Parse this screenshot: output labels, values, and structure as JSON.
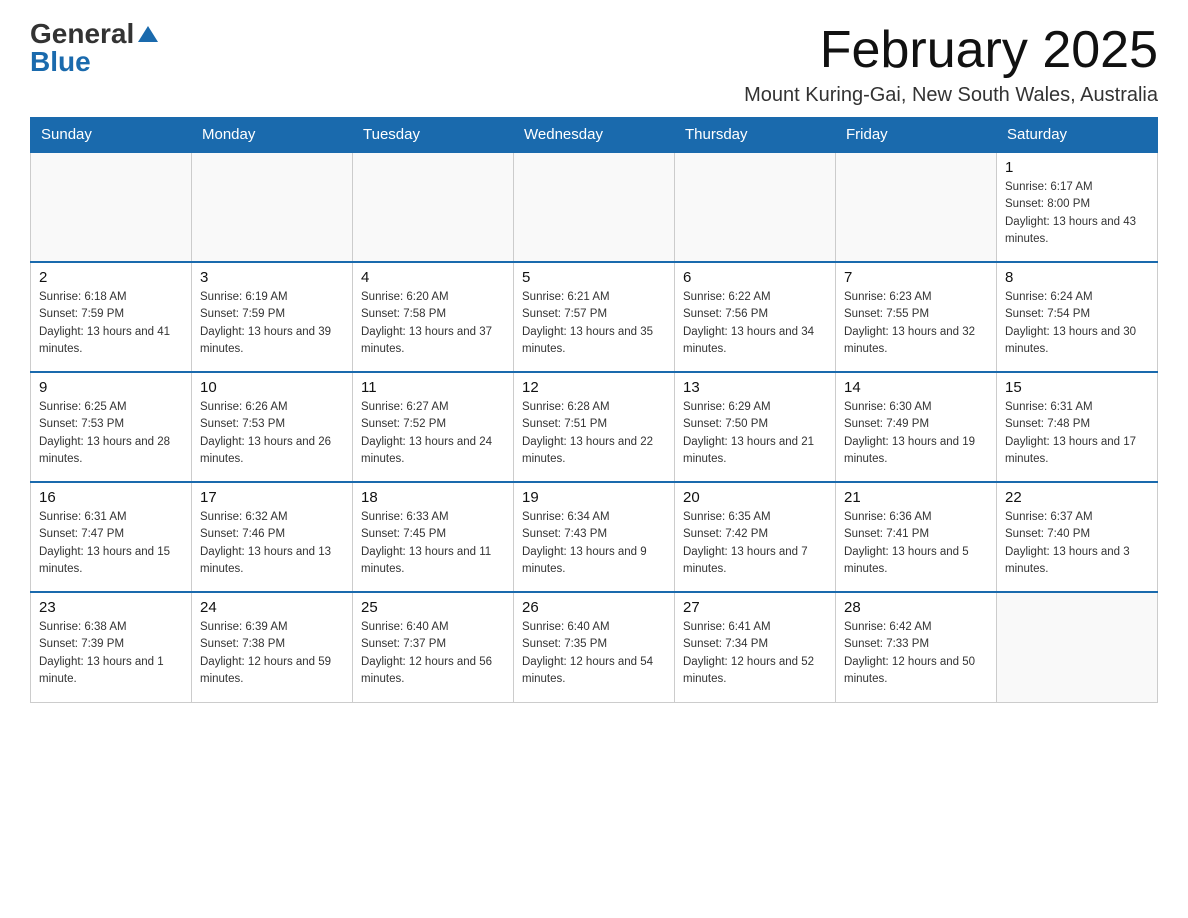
{
  "logo": {
    "general": "General",
    "blue": "Blue"
  },
  "title": "February 2025",
  "location": "Mount Kuring-Gai, New South Wales, Australia",
  "weekdays": [
    "Sunday",
    "Monday",
    "Tuesday",
    "Wednesday",
    "Thursday",
    "Friday",
    "Saturday"
  ],
  "weeks": [
    [
      {
        "day": "",
        "info": ""
      },
      {
        "day": "",
        "info": ""
      },
      {
        "day": "",
        "info": ""
      },
      {
        "day": "",
        "info": ""
      },
      {
        "day": "",
        "info": ""
      },
      {
        "day": "",
        "info": ""
      },
      {
        "day": "1",
        "info": "Sunrise: 6:17 AM\nSunset: 8:00 PM\nDaylight: 13 hours and 43 minutes."
      }
    ],
    [
      {
        "day": "2",
        "info": "Sunrise: 6:18 AM\nSunset: 7:59 PM\nDaylight: 13 hours and 41 minutes."
      },
      {
        "day": "3",
        "info": "Sunrise: 6:19 AM\nSunset: 7:59 PM\nDaylight: 13 hours and 39 minutes."
      },
      {
        "day": "4",
        "info": "Sunrise: 6:20 AM\nSunset: 7:58 PM\nDaylight: 13 hours and 37 minutes."
      },
      {
        "day": "5",
        "info": "Sunrise: 6:21 AM\nSunset: 7:57 PM\nDaylight: 13 hours and 35 minutes."
      },
      {
        "day": "6",
        "info": "Sunrise: 6:22 AM\nSunset: 7:56 PM\nDaylight: 13 hours and 34 minutes."
      },
      {
        "day": "7",
        "info": "Sunrise: 6:23 AM\nSunset: 7:55 PM\nDaylight: 13 hours and 32 minutes."
      },
      {
        "day": "8",
        "info": "Sunrise: 6:24 AM\nSunset: 7:54 PM\nDaylight: 13 hours and 30 minutes."
      }
    ],
    [
      {
        "day": "9",
        "info": "Sunrise: 6:25 AM\nSunset: 7:53 PM\nDaylight: 13 hours and 28 minutes."
      },
      {
        "day": "10",
        "info": "Sunrise: 6:26 AM\nSunset: 7:53 PM\nDaylight: 13 hours and 26 minutes."
      },
      {
        "day": "11",
        "info": "Sunrise: 6:27 AM\nSunset: 7:52 PM\nDaylight: 13 hours and 24 minutes."
      },
      {
        "day": "12",
        "info": "Sunrise: 6:28 AM\nSunset: 7:51 PM\nDaylight: 13 hours and 22 minutes."
      },
      {
        "day": "13",
        "info": "Sunrise: 6:29 AM\nSunset: 7:50 PM\nDaylight: 13 hours and 21 minutes."
      },
      {
        "day": "14",
        "info": "Sunrise: 6:30 AM\nSunset: 7:49 PM\nDaylight: 13 hours and 19 minutes."
      },
      {
        "day": "15",
        "info": "Sunrise: 6:31 AM\nSunset: 7:48 PM\nDaylight: 13 hours and 17 minutes."
      }
    ],
    [
      {
        "day": "16",
        "info": "Sunrise: 6:31 AM\nSunset: 7:47 PM\nDaylight: 13 hours and 15 minutes."
      },
      {
        "day": "17",
        "info": "Sunrise: 6:32 AM\nSunset: 7:46 PM\nDaylight: 13 hours and 13 minutes."
      },
      {
        "day": "18",
        "info": "Sunrise: 6:33 AM\nSunset: 7:45 PM\nDaylight: 13 hours and 11 minutes."
      },
      {
        "day": "19",
        "info": "Sunrise: 6:34 AM\nSunset: 7:43 PM\nDaylight: 13 hours and 9 minutes."
      },
      {
        "day": "20",
        "info": "Sunrise: 6:35 AM\nSunset: 7:42 PM\nDaylight: 13 hours and 7 minutes."
      },
      {
        "day": "21",
        "info": "Sunrise: 6:36 AM\nSunset: 7:41 PM\nDaylight: 13 hours and 5 minutes."
      },
      {
        "day": "22",
        "info": "Sunrise: 6:37 AM\nSunset: 7:40 PM\nDaylight: 13 hours and 3 minutes."
      }
    ],
    [
      {
        "day": "23",
        "info": "Sunrise: 6:38 AM\nSunset: 7:39 PM\nDaylight: 13 hours and 1 minute."
      },
      {
        "day": "24",
        "info": "Sunrise: 6:39 AM\nSunset: 7:38 PM\nDaylight: 12 hours and 59 minutes."
      },
      {
        "day": "25",
        "info": "Sunrise: 6:40 AM\nSunset: 7:37 PM\nDaylight: 12 hours and 56 minutes."
      },
      {
        "day": "26",
        "info": "Sunrise: 6:40 AM\nSunset: 7:35 PM\nDaylight: 12 hours and 54 minutes."
      },
      {
        "day": "27",
        "info": "Sunrise: 6:41 AM\nSunset: 7:34 PM\nDaylight: 12 hours and 52 minutes."
      },
      {
        "day": "28",
        "info": "Sunrise: 6:42 AM\nSunset: 7:33 PM\nDaylight: 12 hours and 50 minutes."
      },
      {
        "day": "",
        "info": ""
      }
    ]
  ]
}
